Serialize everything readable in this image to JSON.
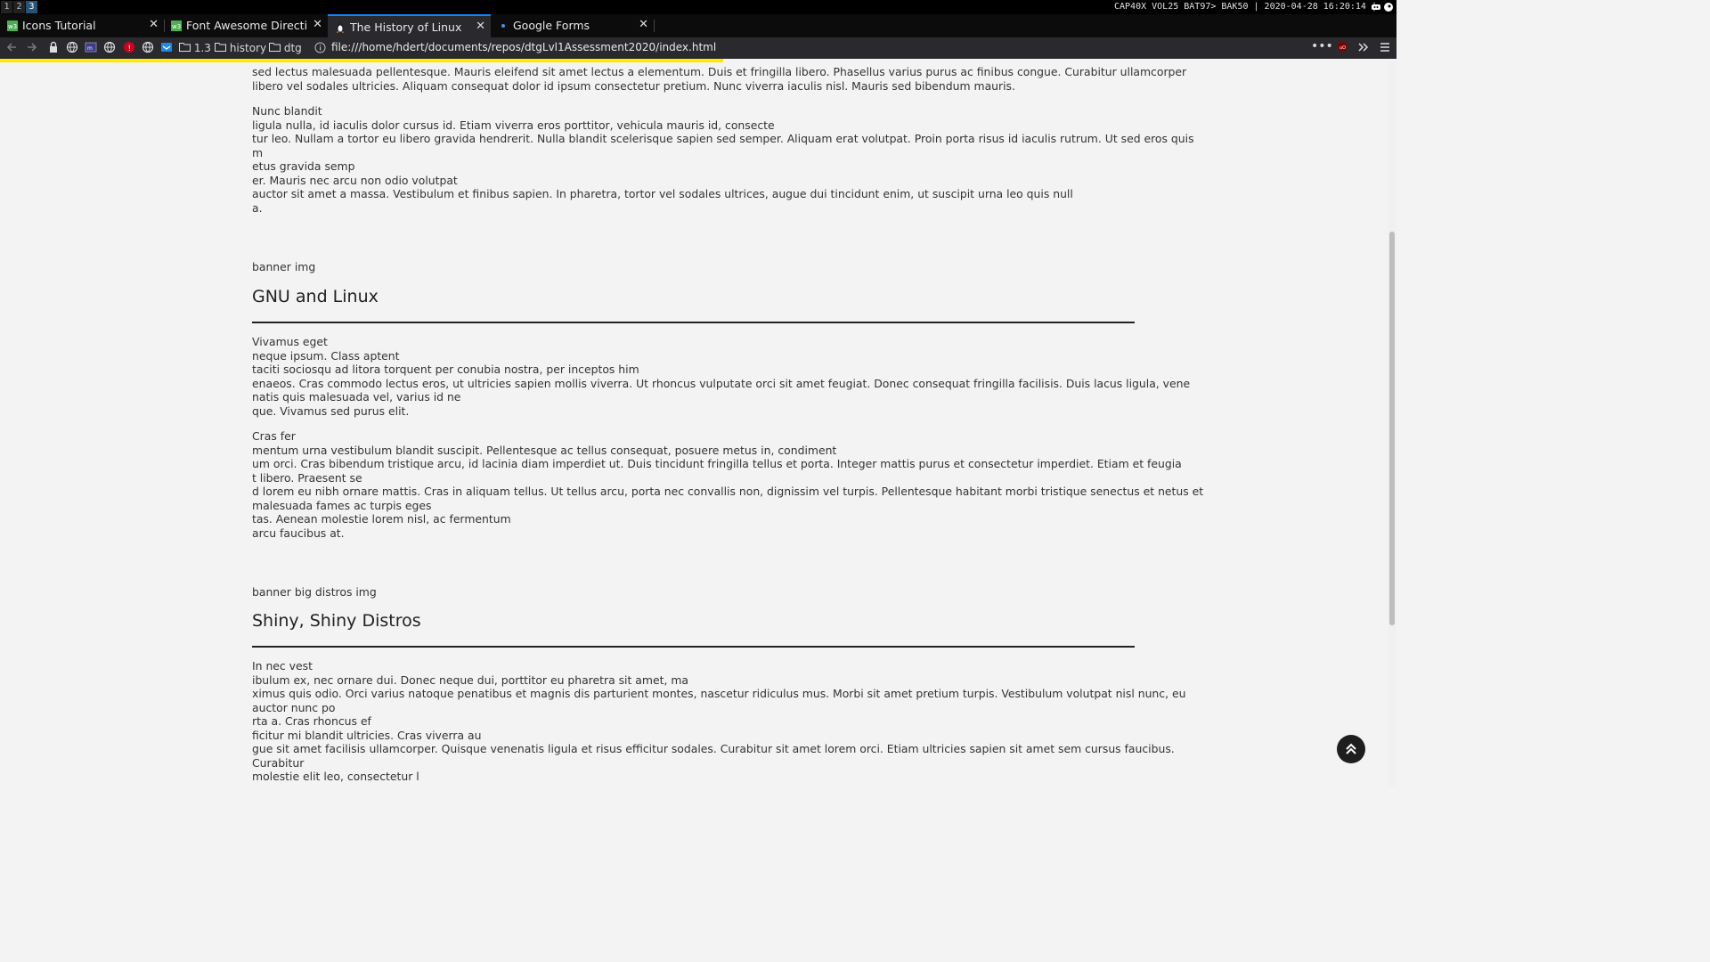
{
  "statusbar": {
    "workspaces": [
      "1",
      "2",
      "3"
    ],
    "active_workspace": "3",
    "status_text": "CAP40X VOL25 BAT97> BAK50 | 2020-04-28 16:20:14 |"
  },
  "tabs": [
    {
      "title": "Icons Tutorial",
      "favicon": "w3schools-icon",
      "active": false
    },
    {
      "title": "Font Awesome Direction",
      "favicon": "w3schools-icon",
      "active": false
    },
    {
      "title": "The History of Linux",
      "favicon": "tux-icon",
      "active": true
    },
    {
      "title": "Google Forms",
      "favicon": "dot-icon",
      "active": false
    }
  ],
  "navbar": {
    "bookmark_1_3": "1.3",
    "bookmark_history": "history",
    "bookmark_dtg": "dtg",
    "url": "file:///home/hdert/documents/repos/dtgLvl1Assessment2020/index.html"
  },
  "content": {
    "top_lines": [
      "sed lectus malesuada pellentesque. Mauris eleifend sit amet lectus a elementum. Duis et fringilla libero. Phasellus varius purus ac finibus congue. Curabitur ullamcorper",
      "libero vel sodales ultricies. Aliquam consequat dolor id ipsum consectetur pretium. Nunc viverra iaculis nisl. Mauris sed bibendum mauris."
    ],
    "para2_lines": [
      "Nunc blandit",
      "ligula nulla, id iaculis dolor cursus id. Etiam viverra eros porttitor, vehicula mauris id, consecte",
      "tur leo. Nullam a tortor eu libero gravida hendrerit. Nulla blandit scelerisque sapien sed semper. Aliquam erat volutpat. Proin porta risus id iaculis rutrum. Ut sed eros quis",
      "m",
      "etus gravida semp",
      "er. Mauris nec arcu non odio volutpat",
      "auctor sit amet a massa. Vestibulum et finibus sapien. In pharetra, tortor vel sodales ultrices, augue dui tincidunt enim, ut suscipit urna leo quis null",
      "a."
    ],
    "banner1": "banner img",
    "heading1": "GNU and Linux",
    "s1p1_lines": [
      "Vivamus eget",
      "neque ipsum. Class aptent",
      "taciti sociosqu ad litora torquent per conubia nostra, per inceptos him",
      "enaeos. Cras commodo lectus eros, ut ultricies sapien mollis viverra. Ut rhoncus vulputate orci sit amet feugiat. Donec consequat fringilla facilisis. Duis lacus ligula, vene",
      "natis quis malesuada vel, varius id ne",
      "que. Vivamus sed purus elit."
    ],
    "s1p2_lines": [
      "Cras fer",
      "mentum urna vestibulum blandit suscipit. Pellentesque ac tellus consequat, posuere metus in, condiment",
      "um orci. Cras bibendum tristique arcu, id lacinia diam imperdiet ut. Duis tincidunt fringilla tellus et porta. Integer mattis purus et consectetur imperdiet. Etiam et feugia",
      "t libero. Praesent se",
      "d lorem eu nibh ornare mattis. Cras in aliquam tellus. Ut tellus arcu, porta nec convallis non, dignissim vel turpis. Pellentesque habitant morbi tristique senectus et netus et",
      "malesuada fames ac turpis eges",
      "tas. Aenean molestie lorem nisl, ac fermentum",
      "arcu faucibus at."
    ],
    "banner2": "banner big distros img",
    "heading2": "Shiny, Shiny Distros",
    "s2p1_lines": [
      "In nec vest",
      "ibulum ex, nec ornare dui. Donec neque dui, porttitor eu pharetra sit amet, ma",
      "ximus quis odio. Orci varius natoque penatibus et magnis dis parturient montes, nascetur ridiculus mus. Morbi sit amet pretium turpis. Vestibulum volutpat nisl nunc, eu",
      "auctor nunc po",
      "rta a. Cras rhoncus ef",
      "ficitur mi blandit ultricies. Cras viverra au",
      "gue sit amet facilisis ullamcorper. Quisque venenatis ligula et risus efficitur sodales. Curabitur sit amet lorem orci. Etiam ultricies sapien sit amet sem cursus faucibus.",
      "Curabitur",
      "molestie elit leo, consectetur l"
    ]
  },
  "colors": {
    "accent": "#0a84ff",
    "load_bar": "#ffe900",
    "page_bg": "#f3f3f3"
  }
}
